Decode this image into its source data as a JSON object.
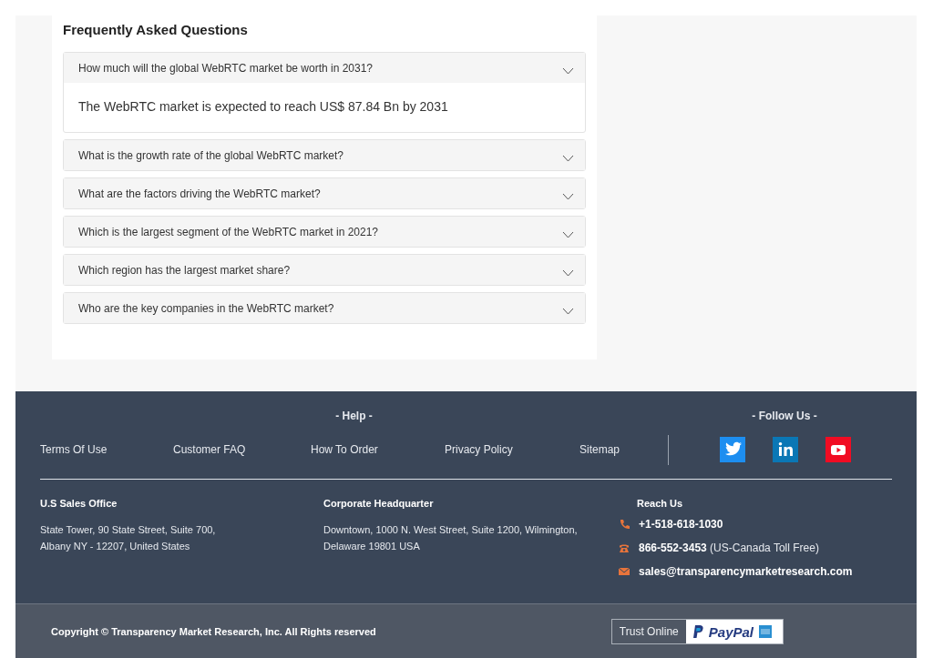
{
  "faq": {
    "title": "Frequently Asked Questions",
    "items": [
      {
        "question": "How much will the global WebRTC market be worth in 2031?",
        "expanded": true,
        "answer": "The WebRTC market is expected to reach US$ 87.84 Bn by 2031"
      },
      {
        "question": "What is the growth rate of the global WebRTC market?",
        "expanded": false
      },
      {
        "question": "What are the factors driving the WebRTC market?",
        "expanded": false
      },
      {
        "question": "Which is the largest segment of the WebRTC market in 2021?",
        "expanded": false
      },
      {
        "question": "Which region has the largest market share?",
        "expanded": false
      },
      {
        "question": "Who are the key companies in the WebRTC market?",
        "expanded": false
      }
    ]
  },
  "footer": {
    "help_heading": "- Help -",
    "follow_heading": "- Follow Us -",
    "links": [
      "Terms Of Use",
      "Customer FAQ",
      "How To Order",
      "Privacy Policy",
      "Sitemap"
    ],
    "social": [
      {
        "kind": "twitter",
        "color": "#1d8ef0"
      },
      {
        "kind": "linkedin",
        "color": "#0a77b5"
      },
      {
        "kind": "youtube",
        "color": "#f10c23"
      }
    ],
    "offices": [
      {
        "title": "U.S Sales Office",
        "lines": [
          "State Tower, 90 State Street, Suite 700,",
          "Albany NY - 12207, United States"
        ]
      },
      {
        "title": "Corporate Headquarter",
        "lines": [
          "Downtown, 1000 N. West Street, Suite 1200, Wilmington,",
          "Delaware 19801 USA"
        ]
      }
    ],
    "reach": {
      "title": "Reach Us",
      "contacts": [
        {
          "kind": "phone",
          "text": "**+1-518-618-1030**"
        },
        {
          "kind": "tollfree",
          "text": "**866-552-3453** (US-Canada Toll Free)"
        },
        {
          "kind": "email",
          "text": "**sales@transparencymarketresearch.com**"
        }
      ]
    }
  },
  "bottom_bar": {
    "copyright": "Copyright © Transparency Market Research, Inc. All Rights reserved",
    "trust_label": "Trust Online",
    "paypal": "PayPal"
  }
}
